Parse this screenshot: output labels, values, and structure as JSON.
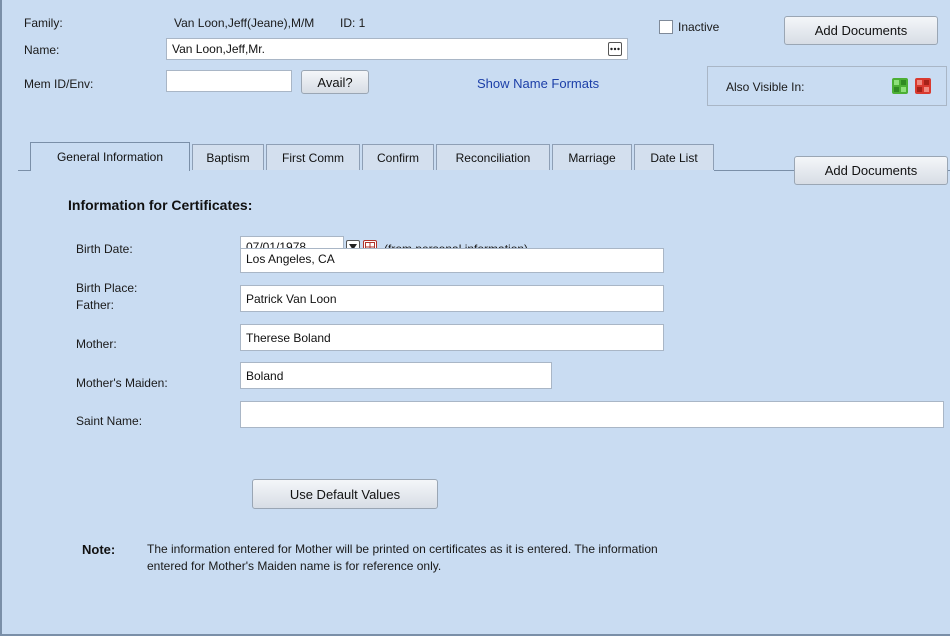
{
  "header": {
    "family_label": "Family:",
    "family_value": "Van Loon,Jeff(Jeane),M/M",
    "id_text": "ID: 1",
    "name_label": "Name:",
    "name_value": "Van Loon,Jeff,Mr.",
    "memid_label": "Mem ID/Env:",
    "memid_value": "",
    "avail_button": "Avail?",
    "show_name_formats": "Show Name Formats",
    "inactive_label": "Inactive",
    "add_documents_top": "Add Documents",
    "also_visible_label": "Also Visible In:"
  },
  "tabs": [
    {
      "label": "General Information"
    },
    {
      "label": "Baptism"
    },
    {
      "label": "First Comm"
    },
    {
      "label": "Confirm"
    },
    {
      "label": "Reconciliation"
    },
    {
      "label": "Marriage"
    },
    {
      "label": "Date List"
    }
  ],
  "main": {
    "section_title": "Information for Certificates:",
    "add_documents": "Add Documents",
    "birth_date_label": "Birth Date:",
    "birth_date_value": "07/01/1978",
    "birth_date_note": "(from personal information)",
    "birth_place_label": "Birth Place:",
    "birth_place_value": "Los Angeles, CA",
    "father_label": "Father:",
    "father_value": "Patrick Van Loon",
    "mother_label": "Mother:",
    "mother_value": "Therese Boland",
    "maiden_label": "Mother's Maiden:",
    "maiden_value": "Boland",
    "saint_label": "Saint Name:",
    "saint_value": "",
    "use_default_button": "Use Default Values",
    "note_label": "Note:",
    "note_line1": "The information entered for Mother will be printed on certificates as it is entered. The information",
    "note_line2": "entered for Mother's Maiden name is for reference only."
  },
  "colors": {
    "background": "#c9dcf2",
    "link": "#1c3fa8"
  }
}
